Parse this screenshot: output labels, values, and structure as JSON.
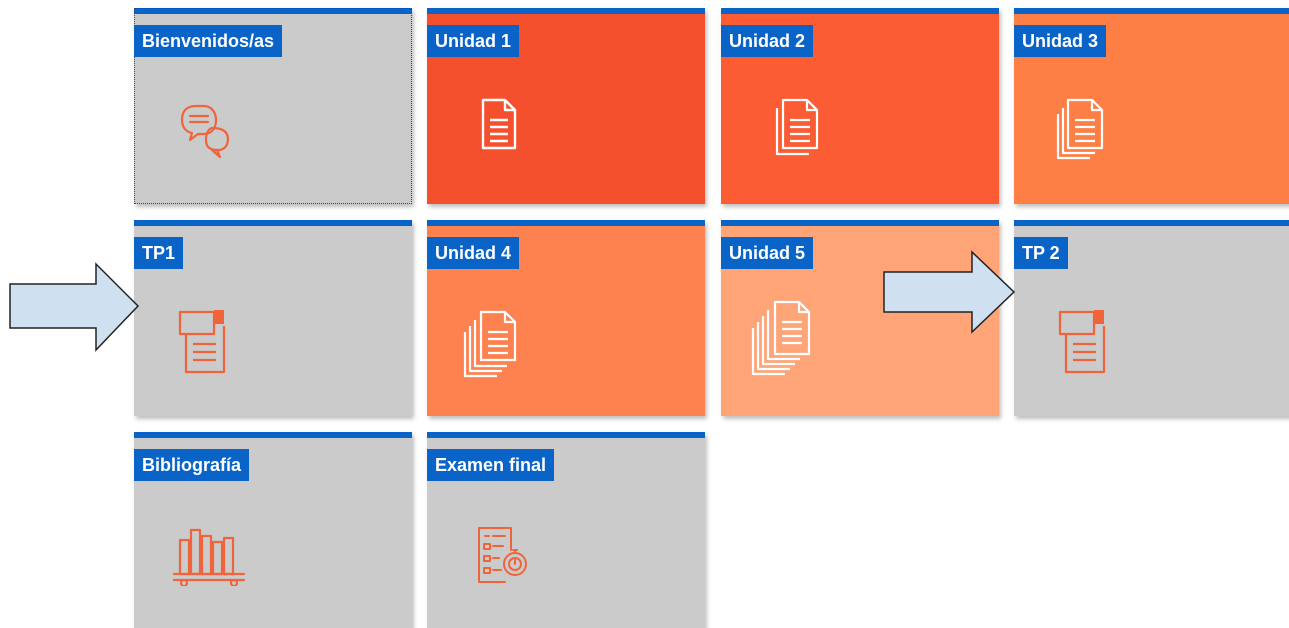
{
  "tiles": {
    "bienvenidos": {
      "label": "Bienvenidos/as",
      "color": "#cbcbcb",
      "icon": "chat-bubbles-icon"
    },
    "unidad1": {
      "label": "Unidad 1",
      "color": "#f4502e",
      "icon": "document-icon"
    },
    "unidad2": {
      "label": "Unidad 2",
      "color": "#fb5c34",
      "icon": "stacked-documents-icon"
    },
    "unidad3": {
      "label": "Unidad 3",
      "color": "#fd7f45",
      "icon": "stacked-documents-icon"
    },
    "tp1": {
      "label": "TP1",
      "color": "#cbcbcb",
      "icon": "assignment-document-icon"
    },
    "unidad4": {
      "label": "Unidad 4",
      "color": "#fe8250",
      "icon": "stacked-documents-icon"
    },
    "unidad5": {
      "label": "Unidad 5",
      "color": "#fea477",
      "icon": "stacked-documents-icon"
    },
    "tp2": {
      "label": "TP 2",
      "color": "#cbcbcb",
      "icon": "assignment-document-icon"
    },
    "bibliografia": {
      "label": "Bibliografía",
      "color": "#cbcbcb",
      "icon": "book-shelf-icon"
    },
    "examen": {
      "label": "Examen final",
      "color": "#cbcbcb",
      "icon": "exam-timer-icon"
    }
  },
  "colors": {
    "accent_blue": "#0a64c8",
    "icon_orange": "#f0643c",
    "arrow_fill": "#cfe0f0"
  }
}
